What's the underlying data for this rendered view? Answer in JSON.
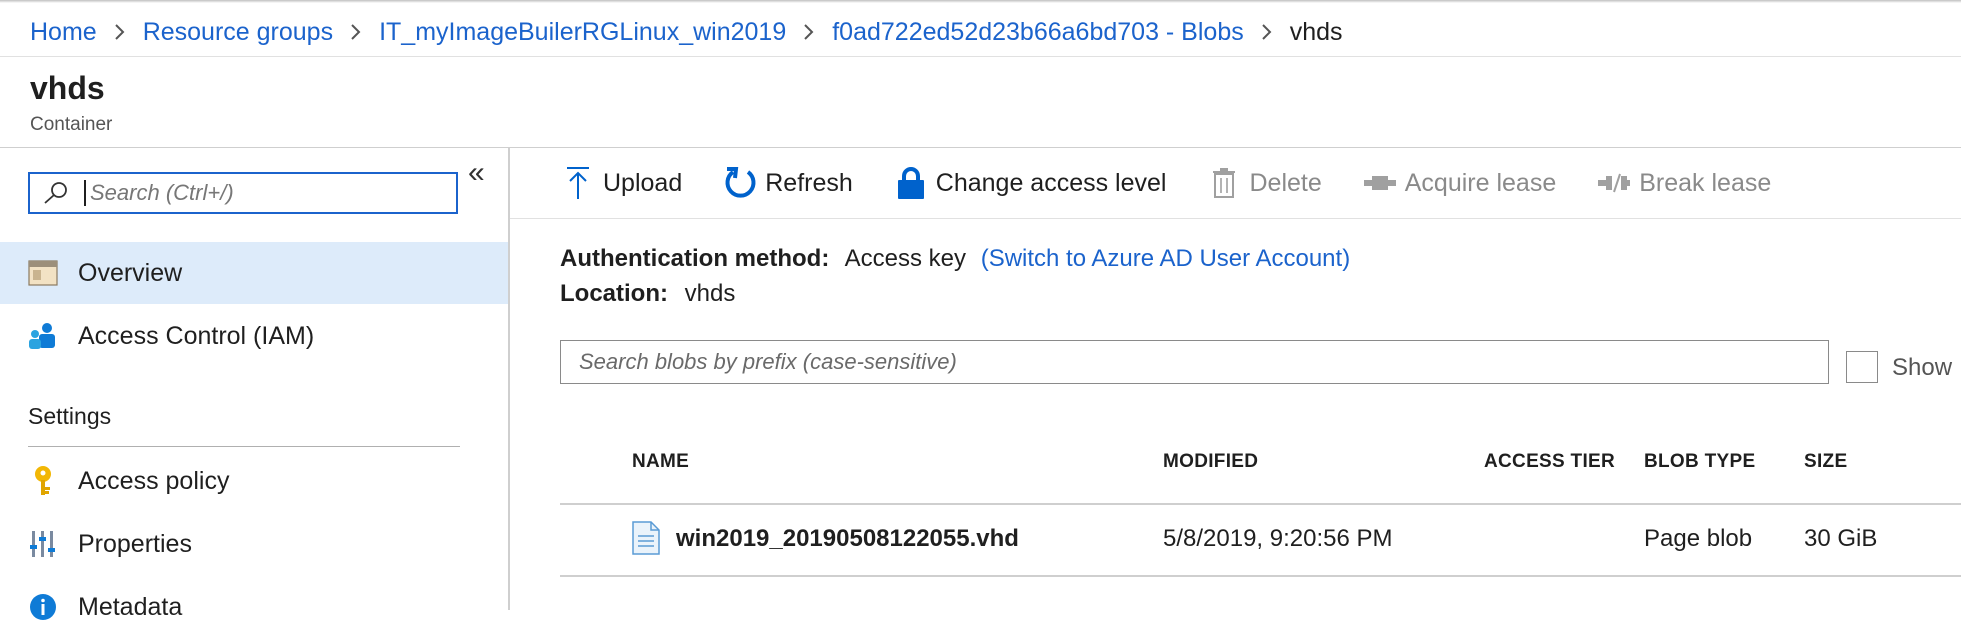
{
  "breadcrumb": {
    "items": [
      "Home",
      "Resource groups",
      "IT_myImageBuilerRGLinux_win2019",
      "f0ad722ed52d23b66a6bd703 - Blobs"
    ],
    "current": "vhds"
  },
  "header": {
    "title": "vhds",
    "subtitle": "Container"
  },
  "sidebar": {
    "search_placeholder": "Search (Ctrl+/)",
    "collapse_glyph": "«",
    "items": [
      {
        "label": "Overview",
        "icon": "container-icon",
        "selected": true
      },
      {
        "label": "Access Control (IAM)",
        "icon": "people-icon",
        "selected": false
      }
    ],
    "section_label": "Settings",
    "settings_items": [
      {
        "label": "Access policy",
        "icon": "key-icon"
      },
      {
        "label": "Properties",
        "icon": "properties-icon"
      },
      {
        "label": "Metadata",
        "icon": "info-icon"
      }
    ]
  },
  "toolbar": {
    "upload": "Upload",
    "refresh": "Refresh",
    "change_access": "Change access level",
    "delete": "Delete",
    "acquire_lease": "Acquire lease",
    "break_lease": "Break lease"
  },
  "info": {
    "auth_label": "Authentication method:",
    "auth_value": "Access key",
    "auth_link": "(Switch to Azure AD User Account)",
    "location_label": "Location:",
    "location_value": "vhds"
  },
  "blob_search": {
    "placeholder": "Search blobs by prefix (case-sensitive)",
    "show_label": "Show"
  },
  "table": {
    "columns": [
      "NAME",
      "MODIFIED",
      "ACCESS TIER",
      "BLOB TYPE",
      "SIZE"
    ],
    "rows": [
      {
        "name": "win2019_20190508122055.vhd",
        "modified": "5/8/2019, 9:20:56 PM",
        "access_tier": "",
        "blob_type": "Page blob",
        "size": "30 GiB"
      }
    ]
  },
  "colors": {
    "link": "#1b63cc",
    "selected_bg": "#ddebfa",
    "icon_blue": "#0062cc"
  }
}
